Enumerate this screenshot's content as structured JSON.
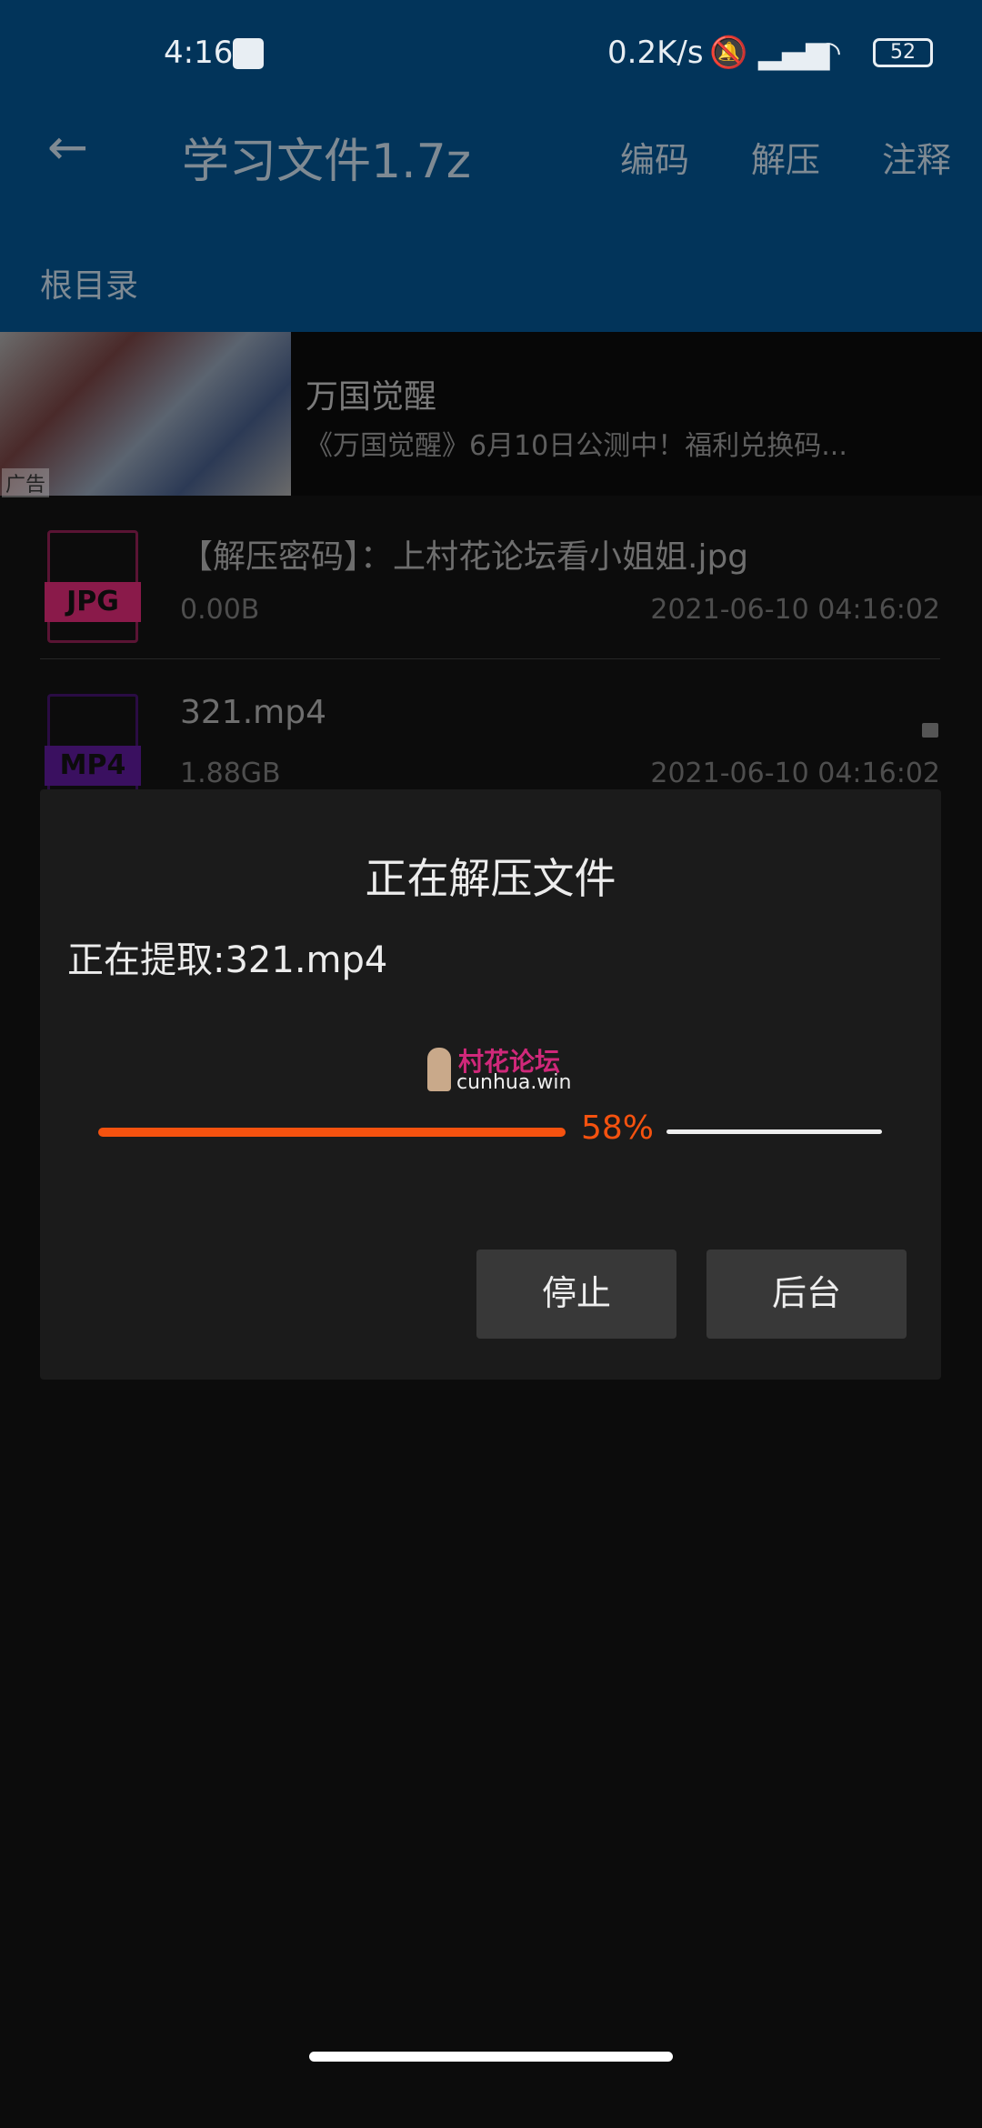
{
  "status_bar": {
    "time": "4:16",
    "net_speed": "0.2K/s",
    "battery": "52"
  },
  "toolbar": {
    "title": "学习文件1.7z",
    "actions": [
      "编码",
      "解压",
      "注释"
    ]
  },
  "breadcrumb": "根目录",
  "ad": {
    "title": "万国觉醒",
    "description": "《万国觉醒》6月10日公测中！福利兑换码...",
    "tag": "广告"
  },
  "files": [
    {
      "type": "JPG",
      "name": "【解压密码】：上村花论坛看小姐姐.jpg",
      "size": "0.00B",
      "date": "2021-06-10 04:16:02",
      "color": "#8a1a4a",
      "locked": false
    },
    {
      "type": "MP4",
      "name": "321.mp4",
      "size": "1.88GB",
      "date": "2021-06-10 04:16:02",
      "color": "#3a1060",
      "locked": true
    }
  ],
  "dialog": {
    "title": "正在解压文件",
    "message": "正在提取:321.mp4",
    "watermark_cn": "村花论坛",
    "watermark_en": "cunhua.win",
    "progress": 58,
    "progress_label": "58%",
    "stop": "停止",
    "background": "后台",
    "accent": "#f5520f"
  }
}
